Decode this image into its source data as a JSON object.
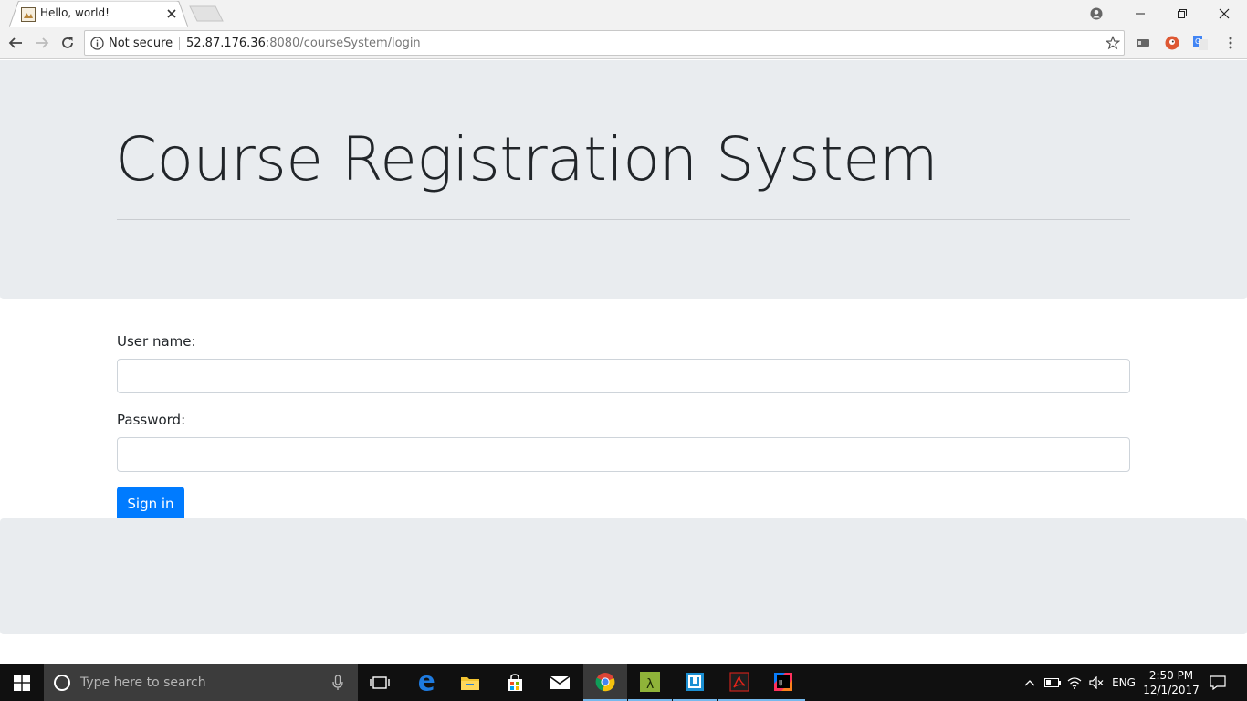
{
  "browser": {
    "tab_title": "Hello, world!",
    "security_label": "Not secure",
    "url_host": "52.87.176.36",
    "url_rest": ":8080/courseSystem/login"
  },
  "page": {
    "title": "Course Registration System",
    "username_label": "User name:",
    "username_value": "",
    "password_label": "Password:",
    "password_value": "",
    "signin_label": "Sign in"
  },
  "colors": {
    "jumbotron_bg": "#e9ecef",
    "primary": "#007bff"
  },
  "taskbar": {
    "search_placeholder": "Type here to search",
    "apps": [
      "task-view-icon",
      "edge-icon",
      "file-explorer-icon",
      "store-icon",
      "mail-icon",
      "chrome-icon",
      "lambda-app-icon",
      "app-icon",
      "acrobat-icon",
      "intellij-icon"
    ],
    "language": "ENG",
    "time": "2:50 PM",
    "date": "12/1/2017"
  }
}
